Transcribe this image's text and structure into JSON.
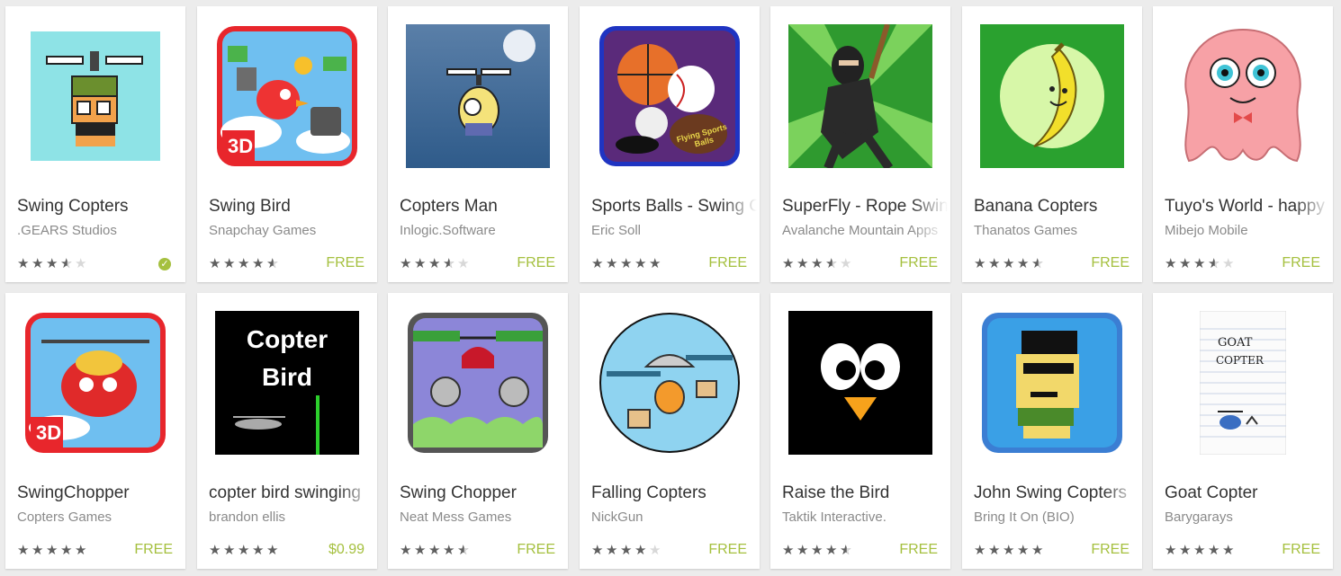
{
  "apps": [
    {
      "title": "Swing Copters",
      "developer": ".GEARS Studios",
      "rating": [
        1,
        1,
        1,
        0.5,
        0
      ],
      "price": "",
      "installed": true,
      "icon": "swing-copters-icon"
    },
    {
      "title": "Swing Bird",
      "developer": "Snapchay Games",
      "rating": [
        1,
        1,
        1,
        1,
        0.5
      ],
      "price": "FREE",
      "installed": false,
      "icon": "swing-bird-icon"
    },
    {
      "title": "Copters Man",
      "developer": "Inlogic.Software",
      "rating": [
        1,
        1,
        1,
        0.5,
        0
      ],
      "price": "FREE",
      "installed": false,
      "icon": "copters-man-icon"
    },
    {
      "title": "Sports Balls - Swing Copters",
      "developer": "Eric Soll",
      "rating": [
        1,
        1,
        1,
        1,
        1
      ],
      "price": "FREE",
      "installed": false,
      "icon": "sports-balls-icon"
    },
    {
      "title": "SuperFly - Rope Swing",
      "developer": "Avalanche Mountain Apps",
      "rating": [
        1,
        1,
        1,
        0.5,
        0
      ],
      "price": "FREE",
      "installed": false,
      "icon": "superfly-icon"
    },
    {
      "title": "Banana Copters",
      "developer": "Thanatos Games",
      "rating": [
        1,
        1,
        1,
        1,
        0.5
      ],
      "price": "FREE",
      "installed": false,
      "icon": "banana-copters-icon"
    },
    {
      "title": "Tuyo's World - happy",
      "developer": "Mibejo Mobile",
      "rating": [
        1,
        1,
        1,
        0.5,
        0
      ],
      "price": "FREE",
      "installed": false,
      "icon": "tuyos-world-icon"
    },
    {
      "title": "SwingChopper",
      "developer": "Copters Games",
      "rating": [
        1,
        1,
        1,
        1,
        1
      ],
      "price": "FREE",
      "installed": false,
      "icon": "swingchopper-icon"
    },
    {
      "title": "copter bird swinging",
      "developer": "brandon ellis",
      "rating": [
        1,
        1,
        1,
        1,
        1
      ],
      "price": "$0.99",
      "installed": false,
      "icon": "copter-bird-icon"
    },
    {
      "title": "Swing Chopper",
      "developer": "Neat Mess Games",
      "rating": [
        1,
        1,
        1,
        1,
        0.5
      ],
      "price": "FREE",
      "installed": false,
      "icon": "swing-chopper-icon"
    },
    {
      "title": "Falling Copters",
      "developer": "NickGun",
      "rating": [
        1,
        1,
        1,
        1,
        0
      ],
      "price": "FREE",
      "installed": false,
      "icon": "falling-copters-icon"
    },
    {
      "title": "Raise the Bird",
      "developer": "Taktik Interactive.",
      "rating": [
        1,
        1,
        1,
        1,
        0.5
      ],
      "price": "FREE",
      "installed": false,
      "icon": "raise-the-bird-icon"
    },
    {
      "title": "John Swing Copters",
      "developer": "Bring It On (BIO)",
      "rating": [
        1,
        1,
        1,
        1,
        1
      ],
      "price": "FREE",
      "installed": false,
      "icon": "john-swing-copters-icon"
    },
    {
      "title": "Goat Copter",
      "developer": "Barygarays",
      "rating": [
        1,
        1,
        1,
        1,
        1
      ],
      "price": "FREE",
      "installed": false,
      "icon": "goat-copter-icon"
    }
  ],
  "icon_text": {
    "swing_bird_badge": "3D",
    "swingchopper_badge": "3D",
    "copter_bird_line1": "Copter",
    "copter_bird_line2": "Bird",
    "goat_line1": "GOAT",
    "goat_line2": "COPTER",
    "sports_balls_logo": "Flying Sports Balls"
  },
  "colors": {
    "price": "#a5c03f",
    "star": "#5f5f5f",
    "star_empty": "#d8d8d8"
  }
}
